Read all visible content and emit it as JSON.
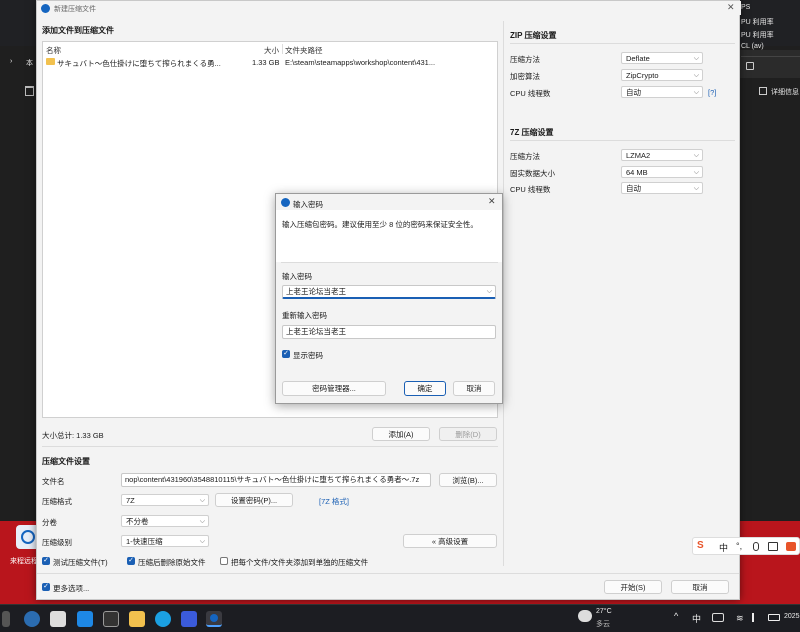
{
  "background": {
    "right_labels": [
      "PS",
      "PU 利用率",
      "PU 利用率",
      "CL (av)"
    ],
    "right_detail": "详细信息",
    "left_char": "本",
    "left_arrow": "›",
    "desktop_icon_label": "来程远程"
  },
  "window": {
    "title": "新建压缩文件",
    "add_files_title": "添加文件到压缩文件",
    "columns": {
      "name": "名称",
      "size": "大小",
      "path": "文件夹路径"
    },
    "files": [
      {
        "name": "サキュバト～色仕掛けに堕ちて搾られまくる勇...",
        "size": "1.33 GB",
        "path": "E:\\steam\\steamapps\\workshop\\content\\431..."
      }
    ],
    "total_size": "大小总计: 1.33 GB",
    "add_button": "添加(A)",
    "delete_button": "删除(D)",
    "settings_title": "压缩文件设置",
    "filename_label": "文件名",
    "filename_value": "nop\\content\\431960\\3548810115\\サキュバト～色仕掛けに堕ちて搾られまくる勇者～.7z",
    "browse_button": "浏览(B)...",
    "format_label": "压缩格式",
    "format_value": "7Z",
    "set_password_button": "设置密码(P)...",
    "format_link": "[7Z 格式]",
    "split_label": "分卷",
    "split_value": "不分卷",
    "level_label": "压缩级别",
    "level_value": "1-快速压缩",
    "advanced_button": "« 高级设置",
    "test_archive": "测试压缩文件(T)",
    "delete_after": "压缩后删除原始文件",
    "separate_archives": "把每个文件/文件夹添加到单独的压缩文件",
    "more_options": "更多选项...",
    "start_button": "开始(S)",
    "cancel_button": "取消"
  },
  "zip_settings": {
    "title": "ZIP 压缩设置",
    "method_label": "压缩方法",
    "method_value": "Deflate",
    "encryption_label": "加密算法",
    "encryption_value": "ZipCrypto",
    "threads_label": "CPU 线程数",
    "threads_value": "自动",
    "help_link": "[?]"
  },
  "sevenz_settings": {
    "title": "7Z 压缩设置",
    "method_label": "压缩方法",
    "method_value": "LZMA2",
    "block_label": "固实数据大小",
    "block_value": "64 MB",
    "threads_label": "CPU 线程数",
    "threads_value": "自动"
  },
  "dialog": {
    "title": "输入密码",
    "message": "输入压缩包密码。建议使用至少 8 位的密码来保证安全性。",
    "password_label": "输入密码",
    "password_value": "上老王论坛当老王",
    "reenter_label": "重新输入密码",
    "reenter_value": "上老王论坛当老王",
    "show_password": "显示密码",
    "manager_button": "密码管理器...",
    "ok_button": "确定",
    "cancel_button": "取消"
  },
  "ime_bar": {
    "logo": "S",
    "lang": "中"
  },
  "taskbar": {
    "weather_temp": "27°C",
    "weather_desc": "多云",
    "ime": "中",
    "date_partial": "2025"
  }
}
